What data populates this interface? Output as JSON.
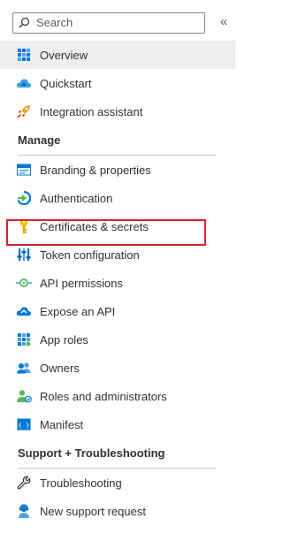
{
  "search": {
    "placeholder": "Search",
    "value": ""
  },
  "collapse_glyph": "«",
  "top_items": [
    {
      "label": "Overview",
      "icon": "overview-grid-icon",
      "selected": true
    },
    {
      "label": "Quickstart",
      "icon": "quickstart-cloud-icon"
    },
    {
      "label": "Integration assistant",
      "icon": "rocket-icon"
    }
  ],
  "sections": [
    {
      "title": "Manage",
      "items": [
        {
          "label": "Branding & properties",
          "icon": "branding-icon"
        },
        {
          "label": "Authentication",
          "icon": "authentication-icon"
        },
        {
          "label": "Certificates & secrets",
          "icon": "key-icon",
          "highlighted": true
        },
        {
          "label": "Token configuration",
          "icon": "token-config-icon"
        },
        {
          "label": "API permissions",
          "icon": "api-permissions-icon"
        },
        {
          "label": "Expose an API",
          "icon": "expose-api-cloud-icon"
        },
        {
          "label": "App roles",
          "icon": "app-roles-icon"
        },
        {
          "label": "Owners",
          "icon": "owners-icon"
        },
        {
          "label": "Roles and administrators",
          "icon": "roles-admins-icon"
        },
        {
          "label": "Manifest",
          "icon": "manifest-icon"
        }
      ]
    },
    {
      "title": "Support + Troubleshooting",
      "items": [
        {
          "label": "Troubleshooting",
          "icon": "wrench-icon"
        },
        {
          "label": "New support request",
          "icon": "support-person-icon"
        }
      ]
    }
  ],
  "colors": {
    "highlight_border": "#d7232a",
    "selected_bg": "#eeeeee",
    "accent": "#0078d4"
  }
}
